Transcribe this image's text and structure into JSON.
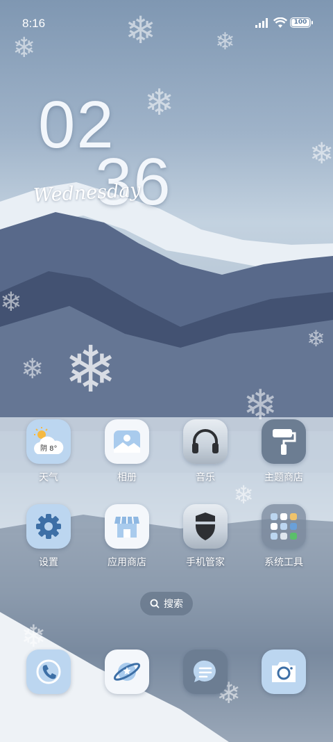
{
  "status": {
    "time": "8:16",
    "battery": "100"
  },
  "clock": {
    "hours": "02",
    "minutes": "36",
    "day": "Wednesday"
  },
  "weather_widget": {
    "temp": "阴 8°"
  },
  "apps": [
    {
      "label": "天气",
      "icon": "weather-icon"
    },
    {
      "label": "相册",
      "icon": "gallery-icon"
    },
    {
      "label": "音乐",
      "icon": "headphones-icon"
    },
    {
      "label": "主题商店",
      "icon": "paint-roller-icon"
    },
    {
      "label": "设置",
      "icon": "gear-icon"
    },
    {
      "label": "应用商店",
      "icon": "store-icon"
    },
    {
      "label": "手机管家",
      "icon": "shield-icon"
    },
    {
      "label": "系统工具",
      "icon": "folder-icon"
    }
  ],
  "search": {
    "label": "搜索"
  },
  "dock": [
    {
      "icon": "phone-icon"
    },
    {
      "icon": "browser-planet-icon"
    },
    {
      "icon": "message-icon"
    },
    {
      "icon": "camera-icon"
    }
  ],
  "colors": {
    "accent_blue": "#bcd6f0",
    "icon_dark": "#6c7d92",
    "glyph_blue": "#3d6fa6"
  }
}
